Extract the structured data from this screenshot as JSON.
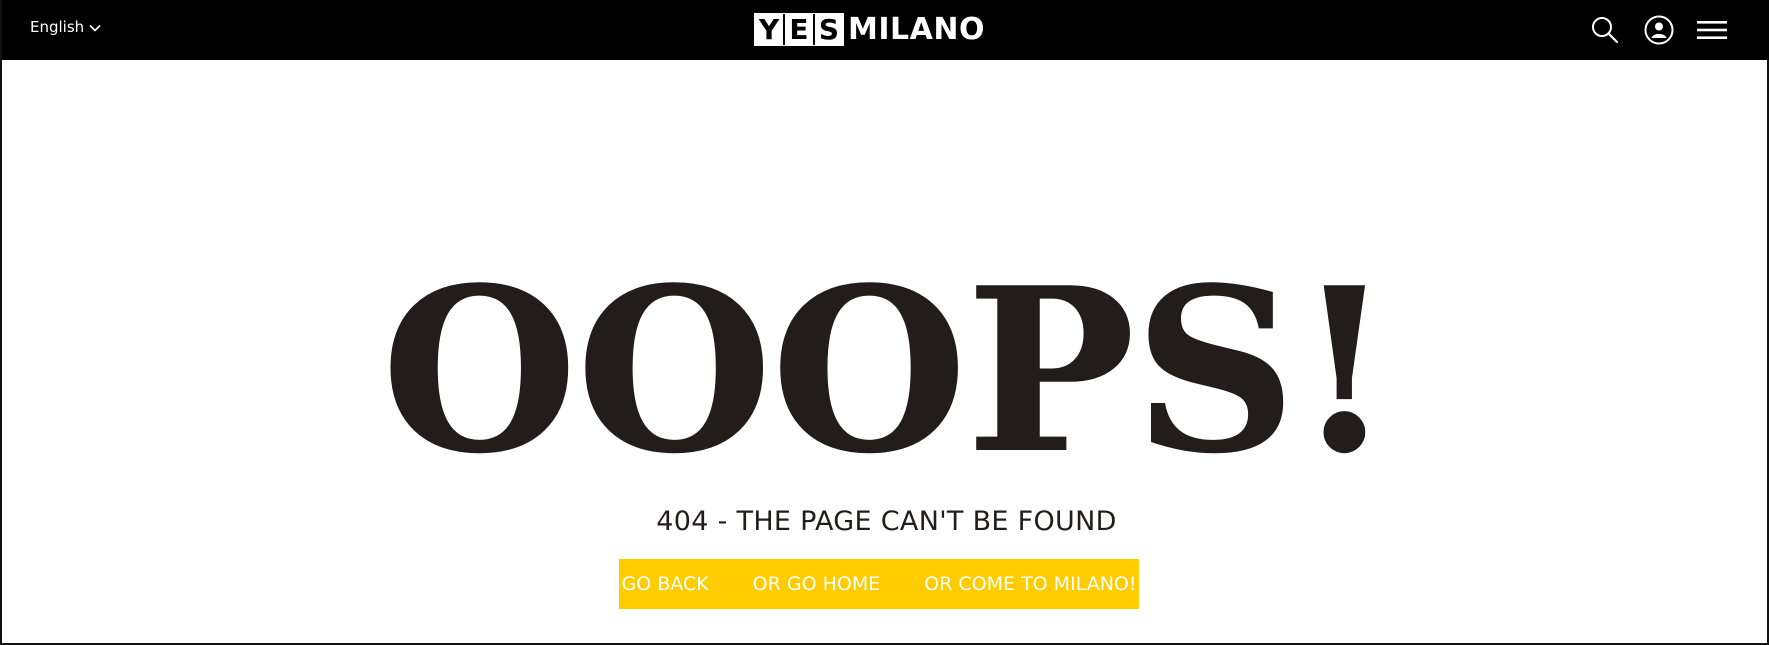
{
  "header": {
    "language": "English",
    "logo": {
      "boxed_letters": [
        "Y",
        "E",
        "S"
      ],
      "word": "MILANO"
    },
    "icons": {
      "search": "search-icon",
      "account": "user-icon",
      "menu": "hamburger-menu-icon"
    }
  },
  "main": {
    "headline": "OOOPS!",
    "subtitle": "404 - THE PAGE CAN'T BE FOUND",
    "actions": [
      {
        "label": "GO BACK"
      },
      {
        "label": "OR GO HOME"
      },
      {
        "label": "OR COME TO MILANO!"
      }
    ]
  },
  "colors": {
    "header_bg": "#000000",
    "accent": "#ffcc00",
    "headline_text": "#221d1b",
    "page_bg": "#ffffff"
  }
}
